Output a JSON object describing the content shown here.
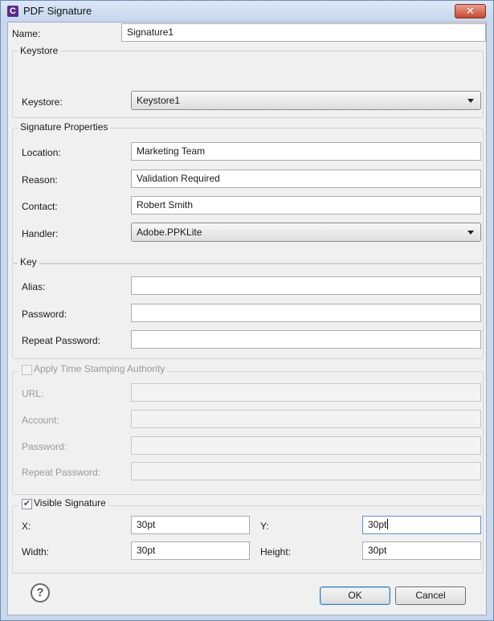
{
  "window": {
    "title": "PDF Signature",
    "app_icon_letter": "C",
    "close_glyph": "✕"
  },
  "name": {
    "label": "Name:",
    "value": "Signature1"
  },
  "keystore": {
    "group_title": "Keystore",
    "label": "Keystore:",
    "selected": "Keystore1"
  },
  "signature_properties": {
    "group_title": "Signature Properties",
    "location": {
      "label": "Location:",
      "value": "Marketing Team"
    },
    "reason": {
      "label": "Reason:",
      "value": "Validation Required"
    },
    "contact": {
      "label": "Contact:",
      "value": "Robert Smith"
    },
    "handler": {
      "label": "Handler:",
      "selected": "Adobe.PPKLite"
    }
  },
  "key": {
    "group_title": "Key",
    "alias": {
      "label": "Alias:",
      "value": ""
    },
    "password": {
      "label": "Password:",
      "value": ""
    },
    "repeat_password": {
      "label": "Repeat Password:",
      "value": ""
    }
  },
  "tsa": {
    "checkbox_label": "Apply Time Stamping Authority",
    "checked": false,
    "enabled": false,
    "url": {
      "label": "URL:",
      "value": ""
    },
    "account": {
      "label": "Account:",
      "value": ""
    },
    "password": {
      "label": "Password:",
      "value": ""
    },
    "repeat_password": {
      "label": "Repeat Password:",
      "value": ""
    }
  },
  "visible_signature": {
    "checkbox_label": "Visible Signature",
    "checked": true,
    "check_glyph": "✔",
    "x": {
      "label": "X:",
      "value": "30pt"
    },
    "y": {
      "label": "Y:",
      "value": "30pt"
    },
    "width": {
      "label": "Width:",
      "value": "30pt"
    },
    "height": {
      "label": "Height:",
      "value": "30pt"
    }
  },
  "footer": {
    "help_glyph": "?",
    "ok_label": "OK",
    "cancel_label": "Cancel"
  },
  "colors": {
    "title_bar": "#c5d7ee",
    "close_button": "#c9472d",
    "dialog_bg": "#f0f0f0",
    "default_button_border": "#3c7fb1"
  },
  "icons": {
    "app": "app-logo-icon",
    "close": "close-icon",
    "help": "help-icon",
    "dropdown": "chevron-down-icon"
  }
}
